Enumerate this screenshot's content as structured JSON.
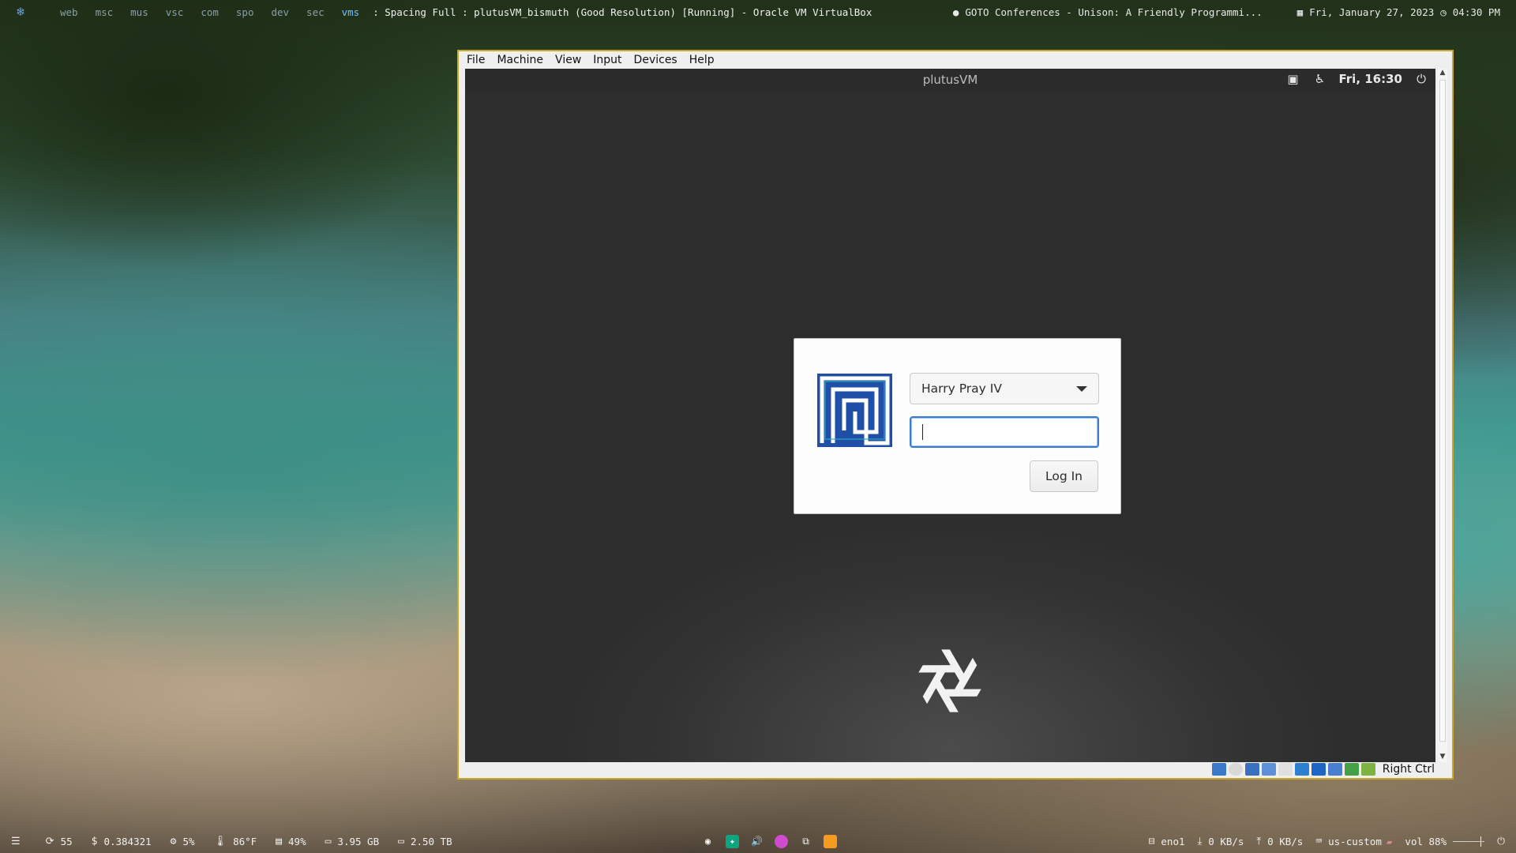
{
  "topbar": {
    "workspaces": [
      "web",
      "msc",
      "mus",
      "vsc",
      "com",
      "spo",
      "dev",
      "sec",
      "vms"
    ],
    "active_workspace": "vms",
    "window_title": ": Spacing Full :  plutusVM_bismuth (Good Resolution) [Running] - Oracle VM VirtualBox",
    "media": "GOTO Conferences - Unison: A Friendly Programmi...",
    "date": "Fri, January 27, 2023",
    "time": "04:30 PM"
  },
  "vbox": {
    "menu": [
      "File",
      "Machine",
      "View",
      "Input",
      "Devices",
      "Help"
    ],
    "host_key": "Right Ctrl"
  },
  "guest": {
    "hostname": "plutusVM",
    "clock": "Fri, 16:30",
    "login": {
      "user": "Harry Pray IV",
      "password_placeholder": "",
      "login_button": "Log In"
    }
  },
  "bottombar": {
    "updates": "55",
    "price": "0.384321",
    "cpu": "5%",
    "temperature": "86°F",
    "memory": "49%",
    "disk1": "3.95 GB",
    "disk2": "2.50 TB",
    "network_interface": "eno1",
    "download": "0 KB/s",
    "upload": "0 KB/s",
    "keyboard_layout": "us-custom",
    "volume": "vol 88%"
  },
  "colors": {
    "accent_blue": "#3d7ccf",
    "vbox_border": "#c8a82c",
    "active_workspace": "#6ec0ff"
  }
}
